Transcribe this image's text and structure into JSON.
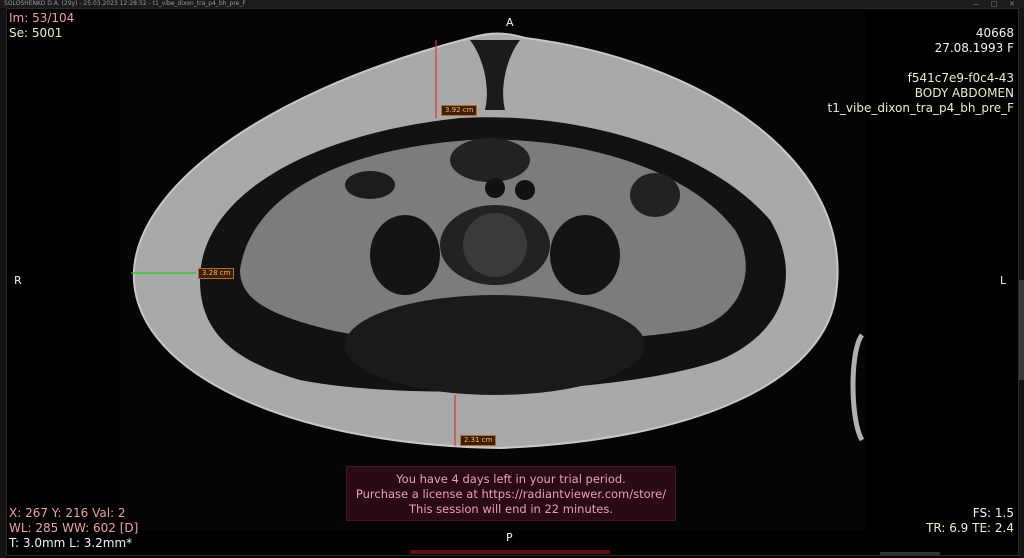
{
  "window": {
    "title": "SOLOSHENKO D.A. (29y) - 25.03.2023 12:28:52 - t1_vibe_dixon_tra_p4_bh_pre_F",
    "controls": [
      "—",
      "□",
      "✕"
    ]
  },
  "overlay": {
    "top_left": {
      "image_index": "Im: 53/104",
      "series": "Se: 5001"
    },
    "top_right": {
      "patient_id": "40668",
      "birth_date": "27.08.1993 F",
      "study_uid": "f541c7e9-f0c4-43",
      "body_part": "BODY ABDOMEN",
      "series_description": "t1_vibe_dixon_tra_p4_bh_pre_F"
    },
    "bottom_left": {
      "cursor": "X: 267 Y: 216 Val: 2",
      "window_level": "WL: 285 WW: 602 [D]",
      "thickness": "T: 3.0mm L: 3.2mm*"
    },
    "bottom_right": {
      "fs": "FS: 1.5",
      "tr_te": "TR: 6.9 TE: 2.4"
    },
    "orientation": {
      "top": "A",
      "bottom": "P",
      "left": "R",
      "right": "L"
    }
  },
  "measurements": [
    {
      "label": "3.92 cm",
      "color": "#d33"
    },
    {
      "label": "3.28 cm",
      "color": "#2c2"
    },
    {
      "label": "2.31 cm",
      "color": "#d33"
    }
  ],
  "trial_banner": {
    "line1": "You have 4 days left in your trial period.",
    "line2": "Purchase a license at https://radiantviewer.com/store/",
    "line3": "This session will end in 22 minutes."
  }
}
